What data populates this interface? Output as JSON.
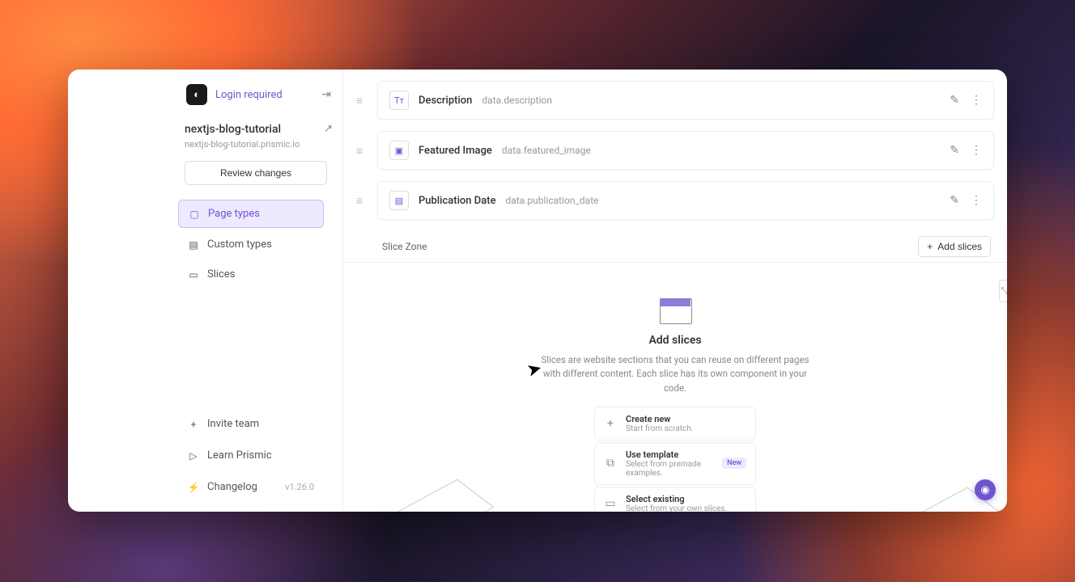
{
  "sidebar": {
    "login_label": "Login required",
    "project_name": "nextjs-blog-tutorial",
    "project_sub": "nextjs-blog-tutorial.prismic.io",
    "review_label": "Review changes",
    "nav": {
      "page_types": "Page types",
      "custom_types": "Custom types",
      "slices": "Slices"
    },
    "bottom": {
      "invite": "Invite team",
      "learn": "Learn Prismic",
      "changelog": "Changelog",
      "version": "v1.26.0"
    }
  },
  "fields": [
    {
      "label": "Description",
      "api": "data.description",
      "icon": "Tт"
    },
    {
      "label": "Featured Image",
      "api": "data.featured_image",
      "icon": "▣"
    },
    {
      "label": "Publication Date",
      "api": "data.publication_date",
      "icon": "▤"
    }
  ],
  "slice_zone": {
    "title": "Slice Zone",
    "add_button": "Add slices"
  },
  "empty": {
    "title": "Add slices",
    "desc": "Slices are website sections that you can reuse on different pages with different content. Each slice has its own component in your code.",
    "options": [
      {
        "title": "Create new",
        "sub": "Start from scratch.",
        "icon": "+"
      },
      {
        "title": "Use template",
        "sub": "Select from premade examples.",
        "icon": "⧉",
        "badge": "New"
      },
      {
        "title": "Select existing",
        "sub": "Select from your own slices.",
        "icon": "▭"
      }
    ]
  }
}
